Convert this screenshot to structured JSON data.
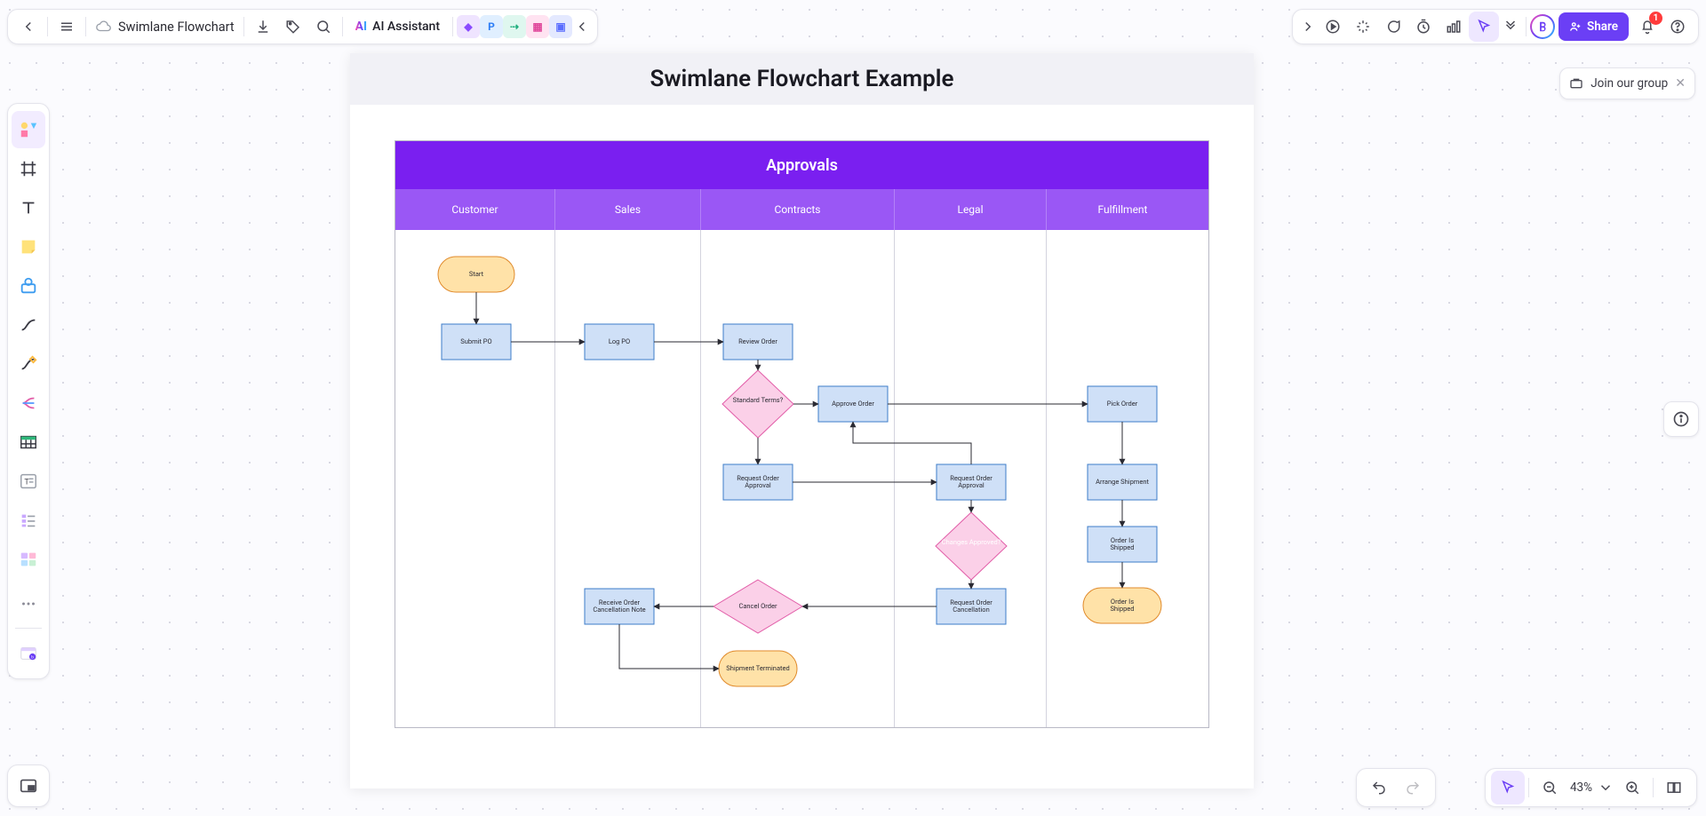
{
  "header": {
    "doc_title": "Swimlane Flowchart",
    "page_title": "Swimlane Flowchart Example",
    "ai_label": "AI Assistant",
    "share_label": "Share",
    "join_label": "Join our group",
    "notification_count": "1"
  },
  "zoom": {
    "value": "43%"
  },
  "swimlane": {
    "title": "Approvals",
    "columns": [
      "Customer",
      "Sales",
      "Contracts",
      "Legal",
      "Fulfillment"
    ]
  },
  "nodes": {
    "start": "Start",
    "submit_po": "Submit PO",
    "log_po": "Log PO",
    "review_order": "Review Order",
    "standard_terms": "Standard Terms?",
    "approve_order": "Approve Order",
    "pick_order": "Pick Order",
    "request_order_approval_c": "Request Order Approval",
    "request_order_approval_l": "Request Order Approval",
    "changes_approved": "Changes Approved?",
    "arrange_shipment": "Arrange Shipment",
    "order_is_shipped": "Order Is Shipped",
    "order_is_shipped_end": "Order Is Shipped",
    "request_order_cancellation": "Request Order Cancellation",
    "cancel_order": "Cancel Order",
    "receive_order_cancel_note": "Receive Order Cancellation Note",
    "shipment_terminated": "Shipment Terminated"
  },
  "colors": {
    "process_fill": "#cfe0f7",
    "process_stroke": "#3d7cc9",
    "terminator_fill": "#ffe2a8",
    "terminator_stroke": "#e08a2b",
    "decision_fill": "#fbd0e8",
    "decision_stroke": "#e25da8",
    "header_fill": "#7a1ff0",
    "subheader_fill": "#9a57f5"
  },
  "left_tools": [
    "shapes",
    "frame",
    "text",
    "sticky",
    "basic-shape",
    "connector",
    "pen",
    "mindmap",
    "table",
    "text-block",
    "list",
    "card-grid"
  ],
  "plugins": [
    "user-purple",
    "p-blue",
    "connector-green",
    "e-pink",
    "comment-blue"
  ]
}
